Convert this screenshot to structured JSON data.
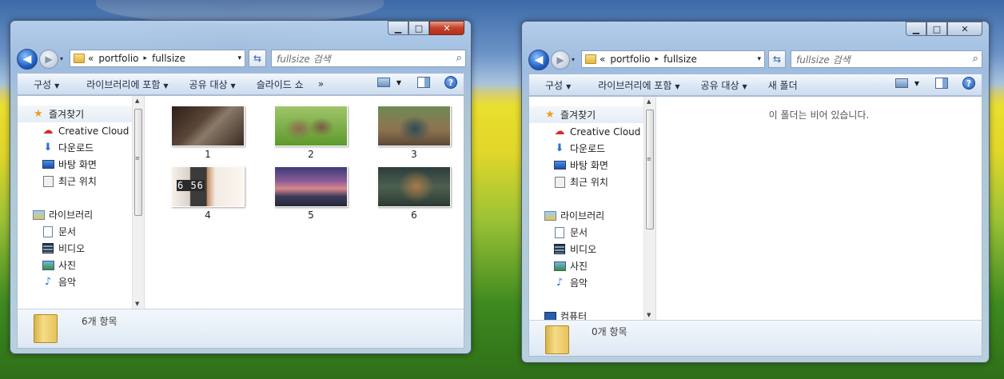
{
  "windows": [
    {
      "caption": {
        "min": "▁",
        "max": "□",
        "close": "✕"
      },
      "nav": {
        "back": "◀",
        "forward": "▶",
        "history_drop": "▾"
      },
      "address": {
        "chevron": "«",
        "crumbs": [
          "portfolio",
          "fullsize"
        ],
        "sep": "▸",
        "drop": "▾"
      },
      "refresh": "⇆",
      "search": {
        "placeholder": "fullsize 검색"
      },
      "toolbar": {
        "items": [
          "구성",
          "라이브러리에 포함",
          "공유 대상",
          "슬라이드 쇼"
        ],
        "overflow": "»",
        "help": "?"
      },
      "navpane": {
        "favorites": "즐겨찾기",
        "creative_cloud": "Creative Cloud F",
        "downloads": "다운로드",
        "desktop": "바탕 화면",
        "recent": "최근 위치",
        "libraries": "라이브러리",
        "documents": "문서",
        "videos": "비디오",
        "pictures": "사진",
        "music": "음악"
      },
      "files": [
        "1",
        "2",
        "3",
        "4",
        "5",
        "6"
      ],
      "thumb4_text": "6 56",
      "status": "6개 항목"
    },
    {
      "caption": {
        "min": "▁",
        "max": "□",
        "close": "✕"
      },
      "nav": {
        "back": "◀",
        "forward": "▶",
        "history_drop": "▾"
      },
      "address": {
        "chevron": "«",
        "crumbs": [
          "portfolio",
          "fullsize"
        ],
        "sep": "▸",
        "drop": "▾"
      },
      "refresh": "⇆",
      "search": {
        "placeholder": "fullsize 검색"
      },
      "toolbar": {
        "items": [
          "구성",
          "라이브러리에 포함",
          "공유 대상",
          "새 폴더"
        ],
        "help": "?"
      },
      "navpane": {
        "favorites": "즐겨찾기",
        "creative_cloud": "Creative Cloud F",
        "downloads": "다운로드",
        "desktop": "바탕 화면",
        "recent": "최근 위치",
        "libraries": "라이브러리",
        "documents": "문서",
        "videos": "비디오",
        "pictures": "사진",
        "music": "음악",
        "computer": "컴퓨터"
      },
      "empty_message": "이 폴더는 비어 있습니다.",
      "status": "0개 항목"
    }
  ]
}
